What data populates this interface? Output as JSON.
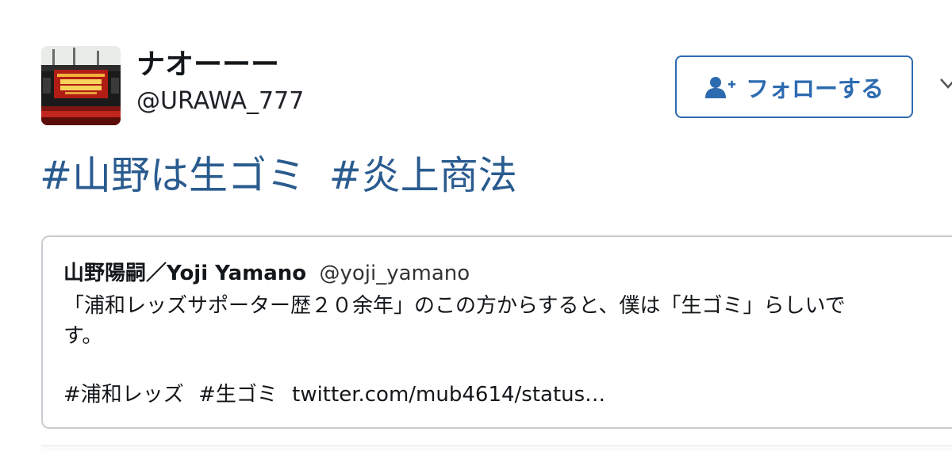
{
  "user": {
    "display_name": "ナオーーー",
    "handle": "@URAWA_777",
    "avatar_icon": "stadium-scoreboard-photo"
  },
  "follow_button": {
    "label": "フォローする",
    "icon": "add-user-icon",
    "color": "#2d6bb0"
  },
  "more_icon": "chevron-down-icon",
  "tweet": {
    "hashtags": [
      "#山野は生ゴミ",
      "#炎上商法"
    ],
    "hashtag_color": "#2a5b8f"
  },
  "quoted_tweet": {
    "name": "山野陽嗣／Yoji Yamano",
    "handle": "@yoji_yamano",
    "body_lines": [
      "「浦和レッズサポーター歴２０余年」のこの方からすると、僕は「生ゴミ」らしいで",
      "す。"
    ],
    "hashtags": [
      "#浦和レッズ",
      "#生ゴミ"
    ],
    "link": "twitter.com/mub4614/status…"
  }
}
